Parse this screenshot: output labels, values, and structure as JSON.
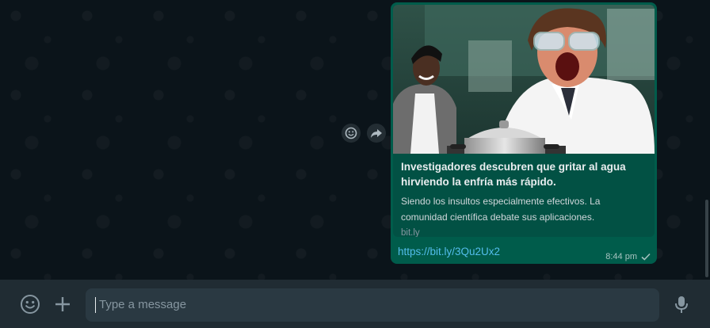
{
  "message": {
    "preview": {
      "title": "Investigadores descubren que gritar al agua hirviendo la enfría más rápido.",
      "description": "Siendo los insultos especialmente efectivos. La comunidad científica debate sus aplicaciones.",
      "domain": "bit.ly",
      "image_icon": "article-photo-scientists-shouting-at-pot"
    },
    "link": "https://bit.ly/3Qu2Ux2",
    "time": "8:44 pm",
    "status_icon": "single-check-icon"
  },
  "hover_actions": {
    "react_icon": "emoji-react-icon",
    "forward_icon": "forward-icon"
  },
  "composer": {
    "placeholder": "Type a message",
    "emoji_icon": "emoji-icon",
    "attach_icon": "plus-icon",
    "mic_icon": "microphone-icon"
  },
  "colors": {
    "chat_background": "#0b141a",
    "outgoing_bubble": "#005c4b",
    "preview_card": "#025144",
    "link": "#53bdeb",
    "footer": "#202c33",
    "input": "#2a3942"
  }
}
